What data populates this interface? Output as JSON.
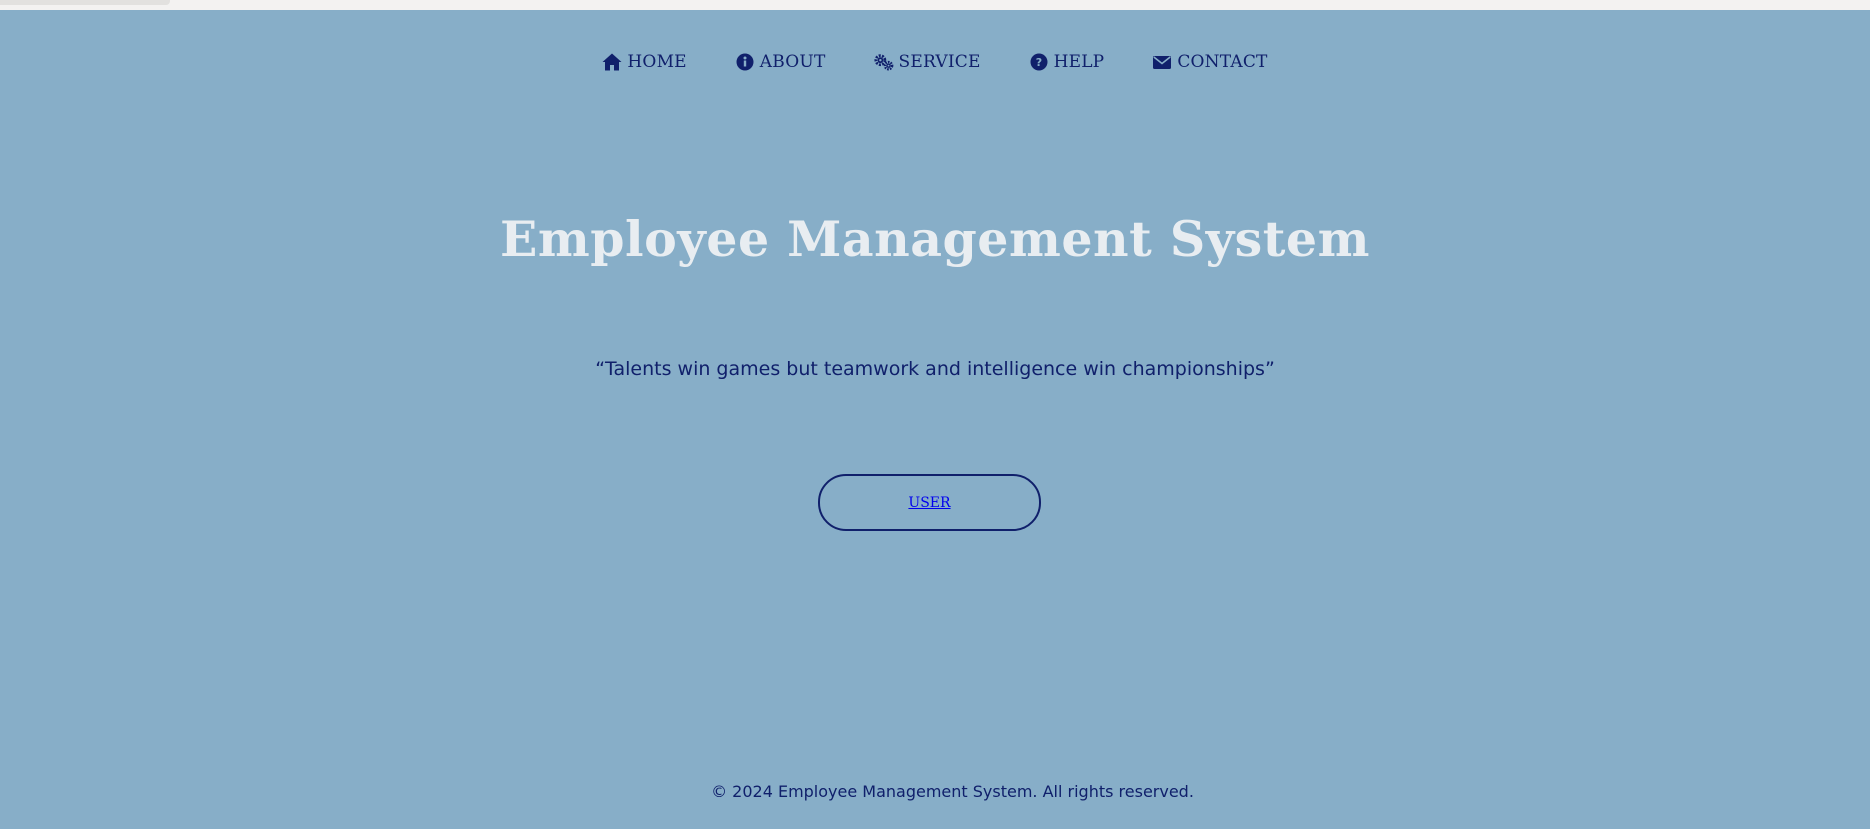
{
  "nav": {
    "items": [
      {
        "label": "HOME",
        "icon": "home-icon"
      },
      {
        "label": "ABOUT",
        "icon": "info-circle-icon"
      },
      {
        "label": "SERVICE",
        "icon": "gears-icon"
      },
      {
        "label": "HELP",
        "icon": "question-circle-icon"
      },
      {
        "label": "CONTACT",
        "icon": "envelope-icon"
      }
    ]
  },
  "hero": {
    "title": "Employee Management System",
    "quote": "“Talents win games but teamwork and intelligence win championships”"
  },
  "cta": {
    "user_label": "USER"
  },
  "footer": {
    "text": "© 2024 Employee Management System. All rights reserved."
  },
  "colors": {
    "background": "#87aec8",
    "nav_text": "#10206b",
    "title_text": "#e8edf1",
    "link": "#0000ee"
  }
}
